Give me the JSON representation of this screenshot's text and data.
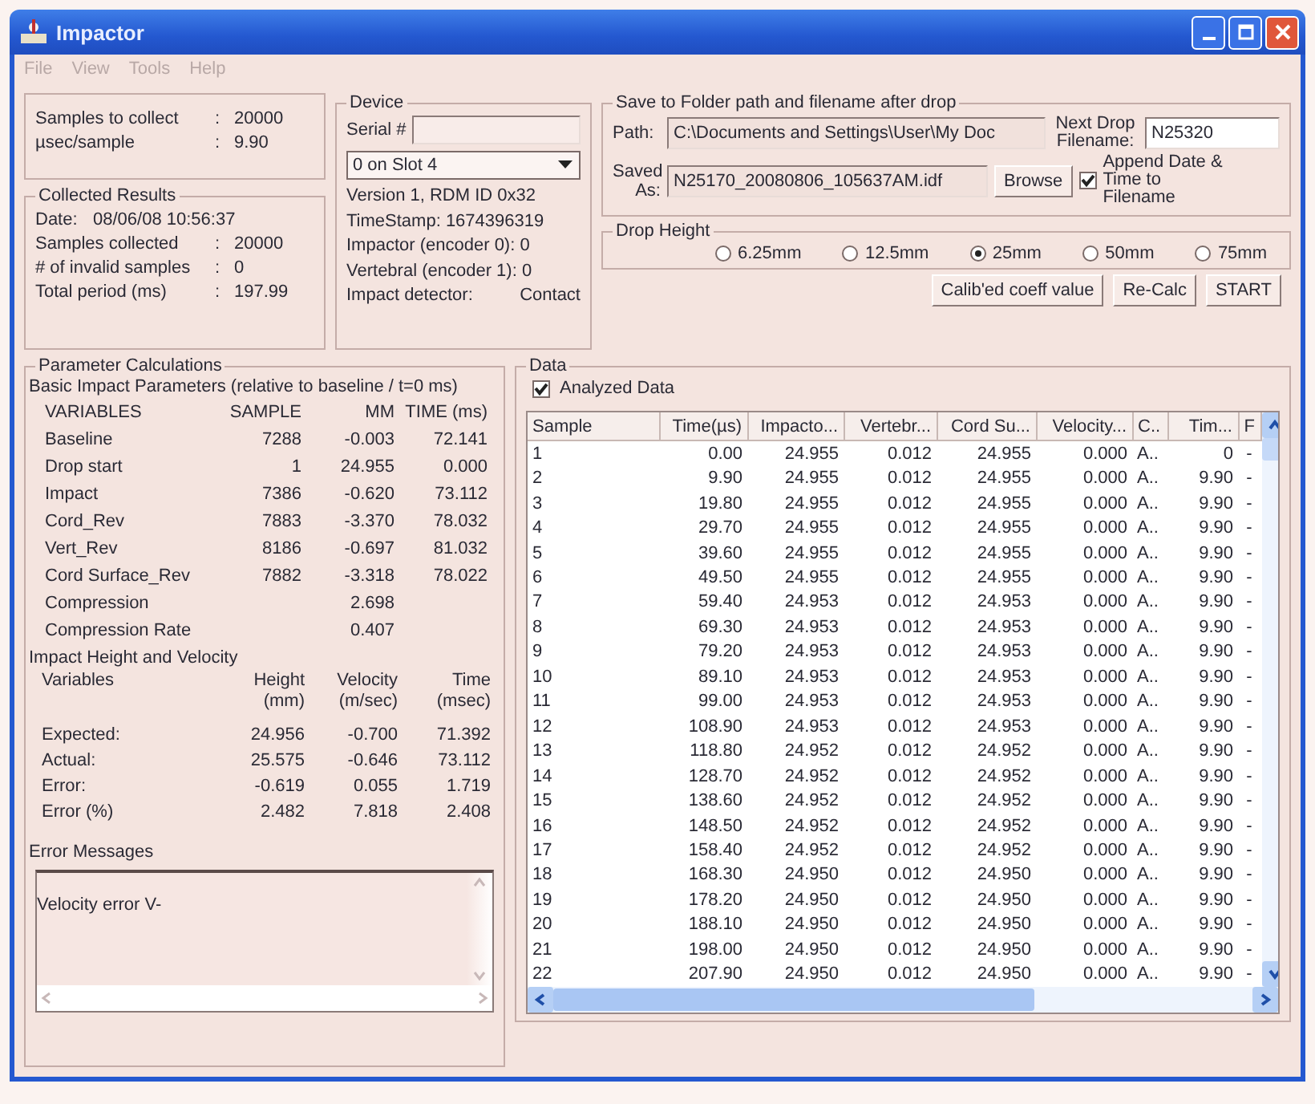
{
  "window": {
    "title": "Impactor"
  },
  "menu": [
    {
      "label": "File",
      "disabled": true
    },
    {
      "label": "View",
      "disabled": true
    },
    {
      "label": "Tools",
      "disabled": true
    },
    {
      "label": "Help",
      "disabled": true
    }
  ],
  "acquisition": {
    "rows": [
      {
        "label": "Samples to collect",
        "sep": ":",
        "value": "20000"
      },
      {
        "label": "µsec/sample",
        "sep": ":",
        "value": "9.90"
      }
    ]
  },
  "collected_results": {
    "title": "Collected Results",
    "date_label": "Date:",
    "date_value": "08/06/08 10:56:37",
    "rows": [
      {
        "label": "Samples collected",
        "sep": ":",
        "value": "20000"
      },
      {
        "label": "# of invalid samples",
        "sep": ":",
        "value": "0"
      },
      {
        "label": "Total period (ms)",
        "sep": ":",
        "value": "197.99"
      }
    ]
  },
  "device": {
    "title": "Device",
    "serial_label": "Serial #",
    "slot": "0 on Slot 4",
    "info": [
      "Version 1, RDM ID 0x32",
      "TimeStamp: 1674396319",
      "Impactor (encoder 0): 0",
      "Vertebral (encoder 1): 0"
    ],
    "detector_label": "Impact detector:",
    "detector_value": "Contact"
  },
  "save": {
    "title": "Save to Folder path and filename after drop",
    "path_label": "Path:",
    "path_value": "C:\\Documents and Settings\\User\\My Doc",
    "next_label": "Next Drop Filename:",
    "next_value": "N25320",
    "saved_label": "Saved As:",
    "saved_value": "N25170_20080806_105637AM.idf",
    "browse": "Browse",
    "append": {
      "label": "Append Date & Time to Filename",
      "checked": true
    }
  },
  "drop_height": {
    "title": "Drop Height",
    "options": [
      {
        "label": "6.25mm",
        "selected": false
      },
      {
        "label": "12.5mm",
        "selected": false
      },
      {
        "label": "25mm",
        "selected": true
      },
      {
        "label": "50mm",
        "selected": false
      },
      {
        "label": "75mm",
        "selected": false
      }
    ]
  },
  "buttons": [
    "Calib'ed coeff value",
    "Re-Calc",
    "START"
  ],
  "parameters": {
    "title": "Parameter Calculations",
    "basic_title": "Basic Impact Parameters (relative to baseline / t=0 ms)",
    "columns": [
      "VARIABLES",
      "SAMPLE",
      "MM",
      "TIME (ms)"
    ],
    "rows": [
      {
        "variable": "Baseline",
        "sample": "7288",
        "mm": "-0.003",
        "time": "72.141"
      },
      {
        "variable": "Drop start",
        "sample": "1",
        "mm": "24.955",
        "time": "0.000"
      },
      {
        "variable": "Impact",
        "sample": "7386",
        "mm": "-0.620",
        "time": "73.112"
      },
      {
        "variable": "Cord_Rev",
        "sample": "7883",
        "mm": "-3.370",
        "time": "78.032"
      },
      {
        "variable": "Vert_Rev",
        "sample": "8186",
        "mm": "-0.697",
        "time": "81.032"
      },
      {
        "variable": "Cord Surface_Rev",
        "sample": "7882",
        "mm": "-3.318",
        "time": "78.022"
      },
      {
        "variable": "Compression",
        "mm": "2.698"
      },
      {
        "variable": "Compression Rate",
        "mm": "0.407"
      }
    ]
  },
  "velocity": {
    "title": "Impact Height and Velocity",
    "columns": [
      {
        "name": "Variables"
      },
      {
        "name": "Height",
        "unit": "(mm)"
      },
      {
        "name": "Velocity",
        "unit": "(m/sec)"
      },
      {
        "name": "Time",
        "unit": "(msec)"
      }
    ],
    "rows": [
      [
        "Expected:",
        "24.956",
        "-0.700",
        "71.392"
      ],
      [
        "Actual:",
        "25.575",
        "-0.646",
        "73.112"
      ],
      [
        "Error:",
        "-0.619",
        "0.055",
        "1.719"
      ],
      [
        "Error (%)",
        "2.482",
        "7.818",
        "2.408"
      ]
    ]
  },
  "error_messages": {
    "title": "Error Messages",
    "text": "Velocity error V-"
  },
  "data": {
    "title": "Data",
    "analyzed": {
      "label": "Analyzed Data",
      "checked": true
    },
    "table": {
      "columns": [
        "Sample",
        "Time(µs)",
        "Impacto...",
        "Vertebr...",
        "Cord Su...",
        "Velocity...",
        "C..",
        "Tim...",
        "F"
      ],
      "rows": [
        [
          "1",
          "0.00",
          "24.955",
          "0.012",
          "24.955",
          "0.000",
          "A..",
          "0",
          "-"
        ],
        [
          "2",
          "9.90",
          "24.955",
          "0.012",
          "24.955",
          "0.000",
          "A..",
          "9.90",
          "-"
        ],
        [
          "3",
          "19.80",
          "24.955",
          "0.012",
          "24.955",
          "0.000",
          "A..",
          "9.90",
          "-"
        ],
        [
          "4",
          "29.70",
          "24.955",
          "0.012",
          "24.955",
          "0.000",
          "A..",
          "9.90",
          "-"
        ],
        [
          "5",
          "39.60",
          "24.955",
          "0.012",
          "24.955",
          "0.000",
          "A..",
          "9.90",
          "-"
        ],
        [
          "6",
          "49.50",
          "24.955",
          "0.012",
          "24.955",
          "0.000",
          "A..",
          "9.90",
          "-"
        ],
        [
          "7",
          "59.40",
          "24.953",
          "0.012",
          "24.953",
          "0.000",
          "A..",
          "9.90",
          "-"
        ],
        [
          "8",
          "69.30",
          "24.953",
          "0.012",
          "24.953",
          "0.000",
          "A..",
          "9.90",
          "-"
        ],
        [
          "9",
          "79.20",
          "24.953",
          "0.012",
          "24.953",
          "0.000",
          "A..",
          "9.90",
          "-"
        ],
        [
          "10",
          "89.10",
          "24.953",
          "0.012",
          "24.953",
          "0.000",
          "A..",
          "9.90",
          "-"
        ],
        [
          "11",
          "99.00",
          "24.953",
          "0.012",
          "24.953",
          "0.000",
          "A..",
          "9.90",
          "-"
        ],
        [
          "12",
          "108.90",
          "24.953",
          "0.012",
          "24.953",
          "0.000",
          "A..",
          "9.90",
          "-"
        ],
        [
          "13",
          "118.80",
          "24.952",
          "0.012",
          "24.952",
          "0.000",
          "A..",
          "9.90",
          "-"
        ],
        [
          "14",
          "128.70",
          "24.952",
          "0.012",
          "24.952",
          "0.000",
          "A..",
          "9.90",
          "-"
        ],
        [
          "15",
          "138.60",
          "24.952",
          "0.012",
          "24.952",
          "0.000",
          "A..",
          "9.90",
          "-"
        ],
        [
          "16",
          "148.50",
          "24.952",
          "0.012",
          "24.952",
          "0.000",
          "A..",
          "9.90",
          "-"
        ],
        [
          "17",
          "158.40",
          "24.952",
          "0.012",
          "24.952",
          "0.000",
          "A..",
          "9.90",
          "-"
        ],
        [
          "18",
          "168.30",
          "24.950",
          "0.012",
          "24.950",
          "0.000",
          "A..",
          "9.90",
          "-"
        ],
        [
          "19",
          "178.20",
          "24.950",
          "0.012",
          "24.950",
          "0.000",
          "A..",
          "9.90",
          "-"
        ],
        [
          "20",
          "188.10",
          "24.950",
          "0.012",
          "24.950",
          "0.000",
          "A..",
          "9.90",
          "-"
        ],
        [
          "21",
          "198.00",
          "24.950",
          "0.012",
          "24.950",
          "0.000",
          "A..",
          "9.90",
          "-"
        ],
        [
          "22",
          "207.90",
          "24.950",
          "0.012",
          "24.950",
          "0.000",
          "A..",
          "9.90",
          "-"
        ]
      ]
    }
  }
}
